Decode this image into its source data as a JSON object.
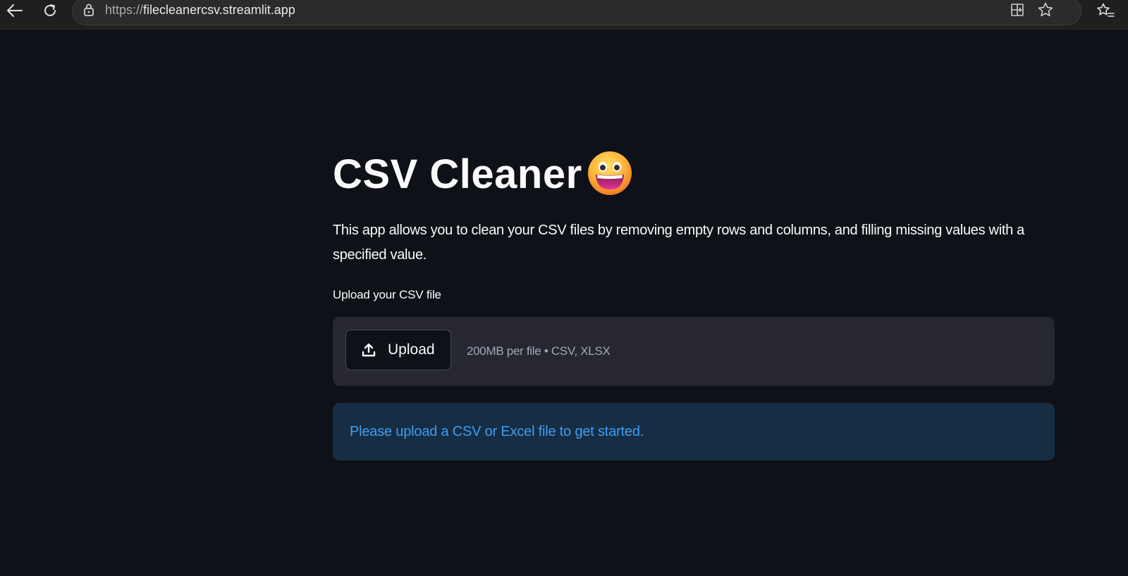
{
  "browser": {
    "url_scheme": "https://",
    "url_host": "filecleanercsv.streamlit.app",
    "icons": {
      "back": "back-arrow-icon",
      "reload": "reload-icon",
      "lock": "lock-icon",
      "split_screen": "split-screen-icon",
      "favorite": "star-icon",
      "favorites": "favorites-icon"
    }
  },
  "page": {
    "title": "CSV Cleaner",
    "title_emoji": "grinning-face-emoji",
    "description": "This app allows you to clean your CSV files by removing empty rows and columns, and filling missing values with a specified value.",
    "uploader": {
      "label": "Upload your CSV file",
      "button_label": "Upload",
      "button_icon": "upload-icon",
      "hint": "200MB per file • CSV, XLSX"
    },
    "info_message": "Please upload a CSV or Excel file to get started."
  },
  "colors": {
    "background": "#0e1117",
    "dropzone": "#262730",
    "info_background": "#172d43",
    "info_text": "#3d9df3",
    "text": "#fafafa"
  }
}
